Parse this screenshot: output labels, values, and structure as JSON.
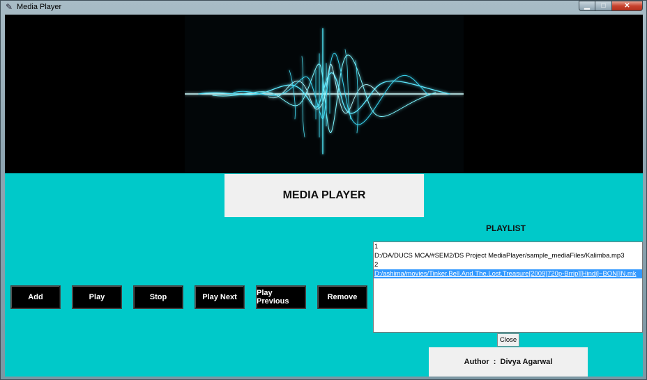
{
  "window": {
    "title": "Media Player",
    "icon": "feather-icon"
  },
  "header": {
    "title": "MEDIA PLAYER"
  },
  "controls": [
    {
      "label": "Add"
    },
    {
      "label": "Play"
    },
    {
      "label": "Stop"
    },
    {
      "label": "Play Next"
    },
    {
      "label": "Play Previous"
    },
    {
      "label": "Remove"
    }
  ],
  "playlist": {
    "title": "PLAYLIST",
    "lines": [
      "1",
      "D:/DA/DUCS MCA/#SEM2/DS Project MediaPlayer/sample_mediaFiles/Kalimba.mp3",
      "2",
      "D:/ashima/movies/Tinker.Bell.And.The.Lost.Treasure[2009]720p-Brrip][Hindi]~BON[IN.mk"
    ],
    "selected_index": 3,
    "close_label": "Close"
  },
  "author": {
    "text": "Author  :  Divya Agarwal"
  },
  "colors": {
    "background": "#00c9c9",
    "video_bg": "#000000",
    "wave": "#6ff3ff",
    "selection": "#3399ff"
  }
}
